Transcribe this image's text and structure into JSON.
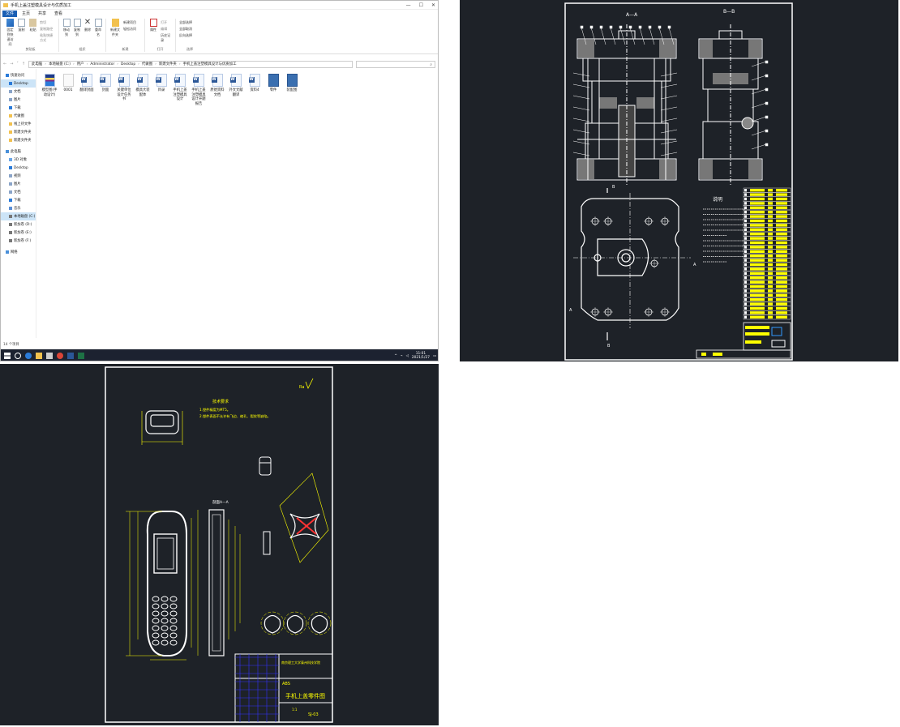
{
  "explorer": {
    "title": "手机上盖注塑模具设计与优质加工",
    "window_controls": [
      "—",
      "☐",
      "✕"
    ],
    "tabs": [
      "文件",
      "主页",
      "共享",
      "查看"
    ],
    "ribbon": {
      "clipboard": {
        "pin": "固定到快速访问",
        "copy": "复制",
        "paste": "粘贴",
        "cut": "剪切",
        "copy_path": "复制路径",
        "paste_shortcut": "粘贴快捷方式",
        "label": "剪贴板"
      },
      "organize": {
        "move_to": "移动到",
        "copy_to": "复制到",
        "delete": "删除",
        "rename": "重命名",
        "label": "组织"
      },
      "new": {
        "new_folder": "新建文件夹",
        "new_item": "新建项目",
        "easy_access": "轻松访问",
        "label": "新建"
      },
      "open": {
        "properties": "属性",
        "open": "打开",
        "edit": "编辑",
        "history": "历史记录",
        "label": "打开"
      },
      "select": {
        "select_all": "全部选择",
        "select_none": "全部取消",
        "invert": "反向选择",
        "label": "选择"
      }
    },
    "path": [
      "此电脑",
      "本地磁盘 (C:)",
      "用户",
      "Administrator",
      "Desktop",
      "代做图",
      "新建文件夹",
      "手机上盖注塑模具设计与优质加工"
    ],
    "search_placeholder": "",
    "nav": [
      {
        "label": "快速访问",
        "color": "#2b7bd9"
      },
      {
        "label": "Desktop",
        "color": "#2b7bd9",
        "selected": true
      },
      {
        "label": "文档",
        "color": "#8aa4c8"
      },
      {
        "label": "图片",
        "color": "#8aa4c8"
      },
      {
        "label": "下载",
        "color": "#2b7bd9"
      },
      {
        "label": "代做图",
        "color": "#f2c14e"
      },
      {
        "label": "线上待文件",
        "color": "#f2c14e"
      },
      {
        "label": "新建文件夹",
        "color": "#f2c14e"
      },
      {
        "label": "新建文件夹",
        "color": "#f2c14e"
      },
      {
        "label": "此电脑",
        "color": "#4a90d9"
      },
      {
        "label": "3D 对象",
        "color": "#6aa6e8"
      },
      {
        "label": "Desktop",
        "color": "#2b7bd9"
      },
      {
        "label": "视频",
        "color": "#8aa4c8"
      },
      {
        "label": "图片",
        "color": "#8aa4c8"
      },
      {
        "label": "文档",
        "color": "#8aa4c8"
      },
      {
        "label": "下载",
        "color": "#2b7bd9"
      },
      {
        "label": "音乐",
        "color": "#5b8fd6"
      },
      {
        "label": "本地磁盘 (C:)",
        "color": "#777",
        "selected": true
      },
      {
        "label": "新加卷 (D:)",
        "color": "#777"
      },
      {
        "label": "新加卷 (E:)",
        "color": "#777"
      },
      {
        "label": "新加卷 (F:)",
        "color": "#777"
      },
      {
        "label": "网络",
        "color": "#4a90d9"
      }
    ],
    "files": [
      {
        "name": "模型图(手动设计)",
        "type": "rar"
      },
      {
        "name": "0001",
        "type": "blank"
      },
      {
        "name": "翻译封面",
        "type": "word"
      },
      {
        "name": "封面",
        "type": "word"
      },
      {
        "name": "关键单位设计任务书",
        "type": "word"
      },
      {
        "name": "模具大装配体",
        "type": "word"
      },
      {
        "name": "目录",
        "type": "word"
      },
      {
        "name": "手机上盖注塑模具设计",
        "type": "word"
      },
      {
        "name": "手机上盖注塑模具设计开题报告",
        "type": "word"
      },
      {
        "name": "原始资料文档",
        "type": "word"
      },
      {
        "name": "外文文献翻译",
        "type": "word"
      },
      {
        "name": "资料4",
        "type": "word"
      },
      {
        "name": "零件",
        "type": "zip"
      },
      {
        "name": "装配图",
        "type": "zip"
      }
    ],
    "status": "14 个项目",
    "clock": {
      "time": "11:01",
      "date": "2021/1/27"
    }
  },
  "cad_assembly": {
    "section_aa": "A—A",
    "section_bb": "B—B",
    "notes_title": "说明",
    "label_a": "A",
    "label_b": "B"
  },
  "cad_part": {
    "tech_req_title": "技术要求",
    "tech_req_1": "1.塑件精度为MT5。",
    "tech_req_2": "2.塑件表面不允许有飞边、缩孔、裂纹等缺陷。",
    "roughness": "Ra",
    "section_label": "剖面A—A",
    "title_block_school": "南京理工大学泰州科技学院",
    "title_block_name": "手机上盖零件图",
    "title_block_material": "ABS",
    "title_block_code": "SJ-03",
    "title_block_scale": "1:1"
  },
  "colors": {
    "cad_bg": "#1e2228",
    "white": "#ffffff",
    "yellow": "#ffff00",
    "blue": "#3333ff",
    "explorer_accent": "#1a5fb4"
  }
}
